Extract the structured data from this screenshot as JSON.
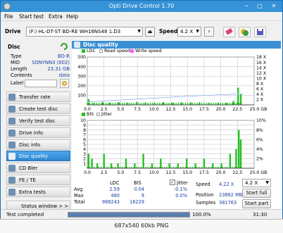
{
  "window": {
    "title": "Opti Drive Control 1.70",
    "minimize": "─",
    "maximize": "□",
    "close": "✕"
  },
  "menu": [
    "File",
    "Start test",
    "Extra",
    "Help"
  ],
  "drive": {
    "label": "Drive",
    "selected": "(F:)  HL-DT-ST BD-RE  WH16NS48 1.D3",
    "speed_label": "Speed",
    "speed_value": "4.2 X"
  },
  "disc": {
    "header": "Disc",
    "fields": [
      {
        "key": "Type",
        "value": "BD-R"
      },
      {
        "key": "MID",
        "value": "SONYNN3 (002)"
      },
      {
        "key": "Length",
        "value": "23.31 GB"
      },
      {
        "key": "Contents",
        "value": "data"
      },
      {
        "key": "Label",
        "value": ""
      }
    ]
  },
  "nav": [
    {
      "label": "Transfer rate",
      "active": false
    },
    {
      "label": "Create test disc",
      "active": false
    },
    {
      "label": "Verify test disc",
      "active": false
    },
    {
      "label": "Drive info",
      "active": false
    },
    {
      "label": "Disc info",
      "active": false
    },
    {
      "label": "Disc quality",
      "active": true
    },
    {
      "label": "CD Bler",
      "active": false
    },
    {
      "label": "FE / TE",
      "active": false
    },
    {
      "label": "Extra tests",
      "active": false
    }
  ],
  "status_window_label": "Status window > >",
  "panel_title": "Disc quality",
  "chart_data": [
    {
      "type": "bar",
      "title": "",
      "legend": [
        "LDC",
        "Read speed",
        "Write speed"
      ],
      "x_ticks": [
        "0.0",
        "2.5",
        "5.0",
        "7.5",
        "10.0",
        "12.5",
        "15.0",
        "17.5",
        "20.0",
        "22.5",
        "25.0 GB"
      ],
      "y_left_ticks": [
        "500",
        "400",
        "300",
        "200",
        "100"
      ],
      "y_right_ticks": [
        "18 X",
        "16 X",
        "14 X",
        "12 X",
        "10 X",
        "8 X",
        "6 X",
        "4 X",
        "2 X"
      ],
      "xlim": [
        0,
        25
      ],
      "ylim": [
        0,
        500
      ],
      "series": [
        {
          "name": "LDC",
          "color": "#22c322",
          "x": [
            0.2,
            1.0,
            2.3,
            3.4,
            4.7,
            6.0,
            7.4,
            8.7,
            10.1,
            11.4,
            12.8,
            14.1,
            15.5,
            16.8,
            18.2,
            19.6,
            20.9,
            21.9,
            22.6,
            23.0
          ],
          "values": [
            60,
            22,
            30,
            25,
            28,
            24,
            30,
            26,
            22,
            28,
            24,
            26,
            26,
            28,
            22,
            24,
            22,
            40,
            180,
            110
          ]
        },
        {
          "name": "Read speed",
          "color": "#ffffff",
          "x": [
            0,
            5,
            10,
            15,
            20,
            23.3
          ],
          "values": [
            1.1,
            1.85,
            2.55,
            3.25,
            3.8,
            4.2
          ]
        }
      ]
    },
    {
      "type": "bar",
      "title": "",
      "legend": [
        "BIS",
        "Jitter"
      ],
      "x_ticks": [
        "0.0",
        "2.5",
        "5.0",
        "7.5",
        "10.0",
        "12.5",
        "15.0",
        "17.5",
        "20.0",
        "22.5",
        "25.0 GB"
      ],
      "y_left_ticks": [
        "10",
        "9",
        "8",
        "7",
        "6",
        "5",
        "4",
        "3",
        "2",
        "1"
      ],
      "y_right_ticks": [
        "10%",
        "8%",
        "6%",
        "4%",
        "2%"
      ],
      "xlim": [
        0,
        25
      ],
      "ylim": [
        0,
        10
      ],
      "series": [
        {
          "name": "BIS",
          "color": "#22c322",
          "x": [
            0.2,
            0.7,
            1.5,
            2.5,
            3.6,
            4.6,
            5.8,
            7.1,
            8.4,
            9.7,
            11.0,
            12.3,
            13.6,
            14.9,
            16.2,
            17.5,
            18.8,
            20.1,
            21.4,
            22.3,
            22.7,
            23.0
          ],
          "values": [
            3,
            2,
            1,
            3,
            1,
            1,
            2,
            1,
            3,
            1,
            2,
            1,
            1,
            2,
            1,
            2,
            1,
            1,
            3,
            4,
            8,
            6
          ]
        }
      ]
    }
  ],
  "stats": {
    "col_ldc": "LDC",
    "col_bis": "BIS",
    "jitter_check": "Jitter",
    "rows": [
      {
        "label": "Avg",
        "ldc": "2.59",
        "bis": "0.04",
        "jitter": "-0.1%"
      },
      {
        "label": "Max",
        "ldc": "480",
        "bis": "9",
        "jitter": "0.0%"
      },
      {
        "label": "Total",
        "ldc": "988243",
        "bis": "16229",
        "jitter": ""
      }
    ],
    "speed_label": "Speed",
    "speed_value": "4.22 X",
    "speed_select": "4.2 X",
    "position_label": "Position",
    "position_value": "23862 MB",
    "samples_label": "Samples",
    "samples_value": "381763",
    "btn_start_full": "Start full",
    "btn_start_part": "Start part"
  },
  "status": {
    "text": "Test completed",
    "progress": 100.0,
    "progress_text": "100.0%",
    "time": "31:30"
  },
  "footer": "687x540  60kb  PNG"
}
